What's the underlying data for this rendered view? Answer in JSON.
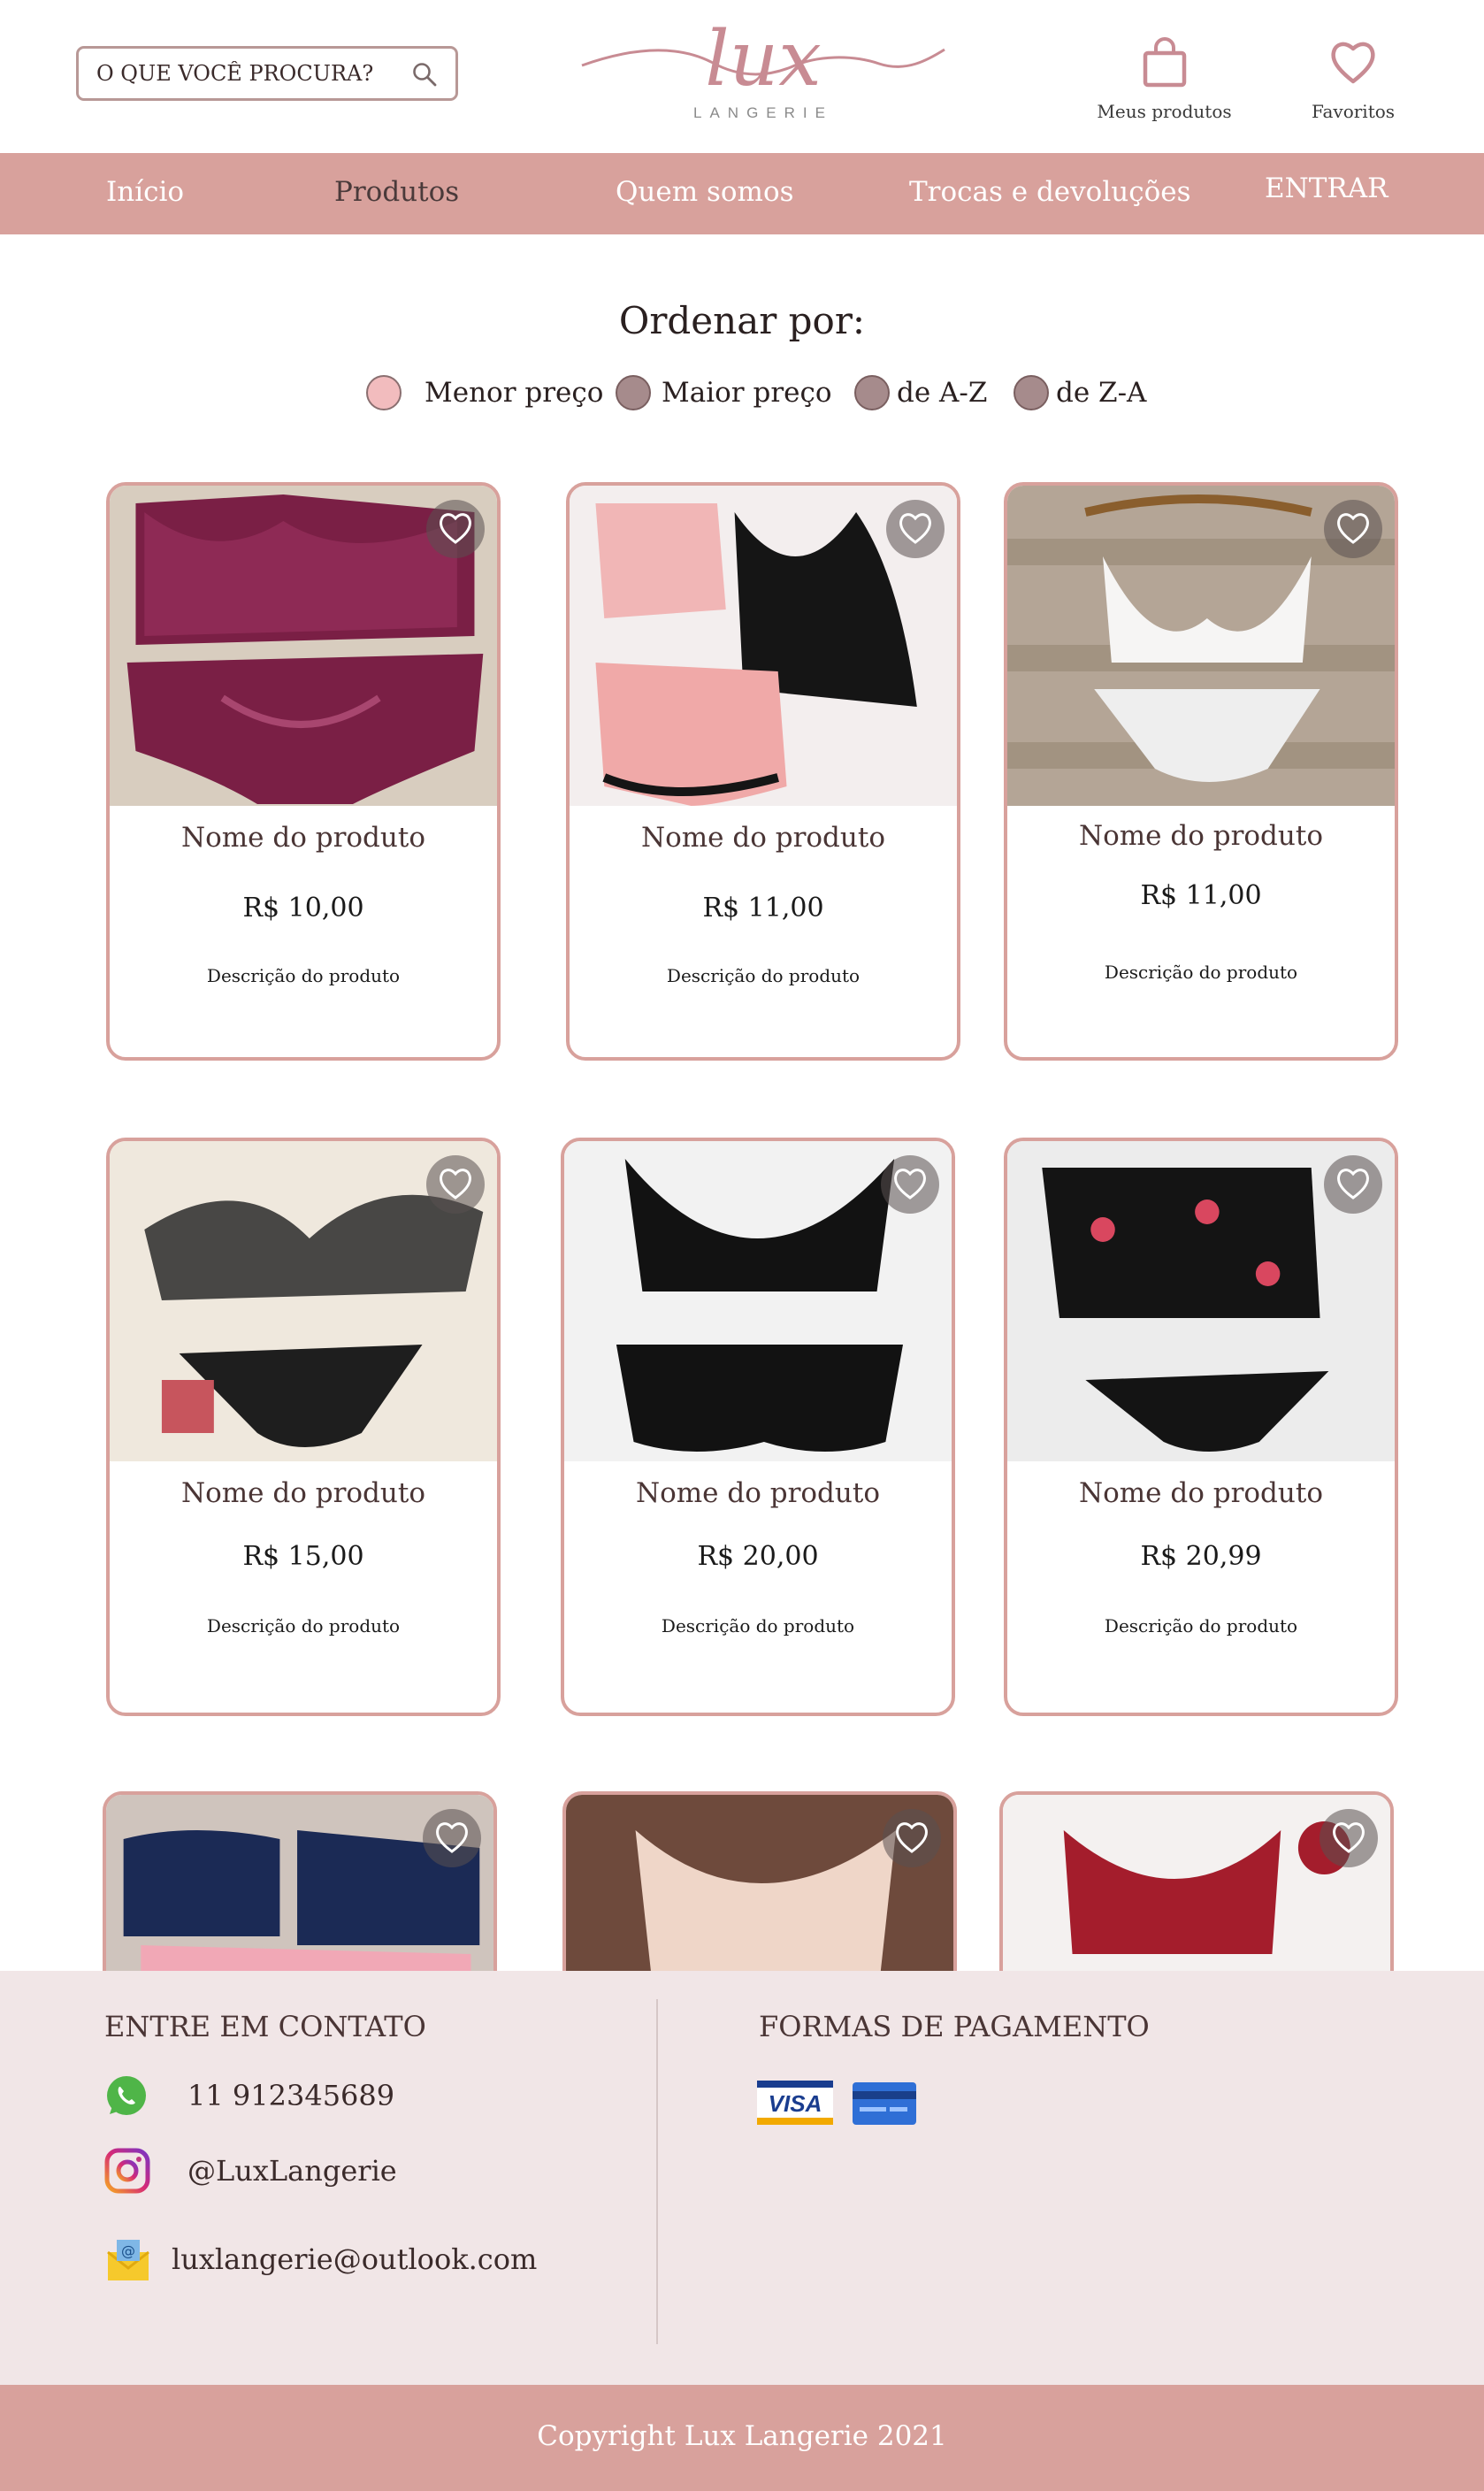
{
  "header": {
    "search_placeholder": "O QUE VOCÊ PROCURA?",
    "logo_text": "lux",
    "logo_sub": "LANGERIE",
    "my_products_label": "Meus produtos",
    "favorites_label": "Favoritos"
  },
  "nav": {
    "items": [
      "Início",
      "Produtos",
      "Quem somos",
      "Trocas e devoluções",
      "ENTRAR"
    ],
    "active": "Produtos"
  },
  "sort": {
    "title": "Ordenar por:",
    "options": [
      "Menor preço",
      "Maior preço",
      "de A-Z",
      "de Z-A"
    ],
    "selected": "Menor preço"
  },
  "products": [
    {
      "name": "Nome do produto",
      "price": "R$ 10,00",
      "description": "Descrição do produto"
    },
    {
      "name": "Nome do produto",
      "price": "R$ 11,00",
      "description": "Descrição do produto"
    },
    {
      "name": "Nome do produto",
      "price": "R$ 11,00",
      "description": "Descrição do produto"
    },
    {
      "name": "Nome do produto",
      "price": "R$ 15,00",
      "description": "Descrição do produto"
    },
    {
      "name": "Nome do produto",
      "price": "R$ 20,00",
      "description": "Descrição do produto"
    },
    {
      "name": "Nome do produto",
      "price": "R$ 20,99",
      "description": "Descrição do produto"
    },
    {
      "name": "",
      "price": "",
      "description": ""
    },
    {
      "name": "",
      "price": "",
      "description": ""
    },
    {
      "name": "",
      "price": "",
      "description": ""
    }
  ],
  "contact": {
    "title": "ENTRE EM CONTATO",
    "phone": "11 912345689",
    "instagram": "@LuxLangerie",
    "email": "luxlangerie@outlook.com"
  },
  "payment": {
    "title": "FORMAS DE PAGAMENTO",
    "methods": [
      "VISA",
      "credit-card"
    ]
  },
  "footer": {
    "copyright": "Copyright Lux Langerie 2021"
  },
  "colors": {
    "accent": "#d8a19c",
    "footer_bg": "#f1e6e7",
    "radio_selected": "#f2bcbe",
    "radio_default": "#a68b8c"
  }
}
